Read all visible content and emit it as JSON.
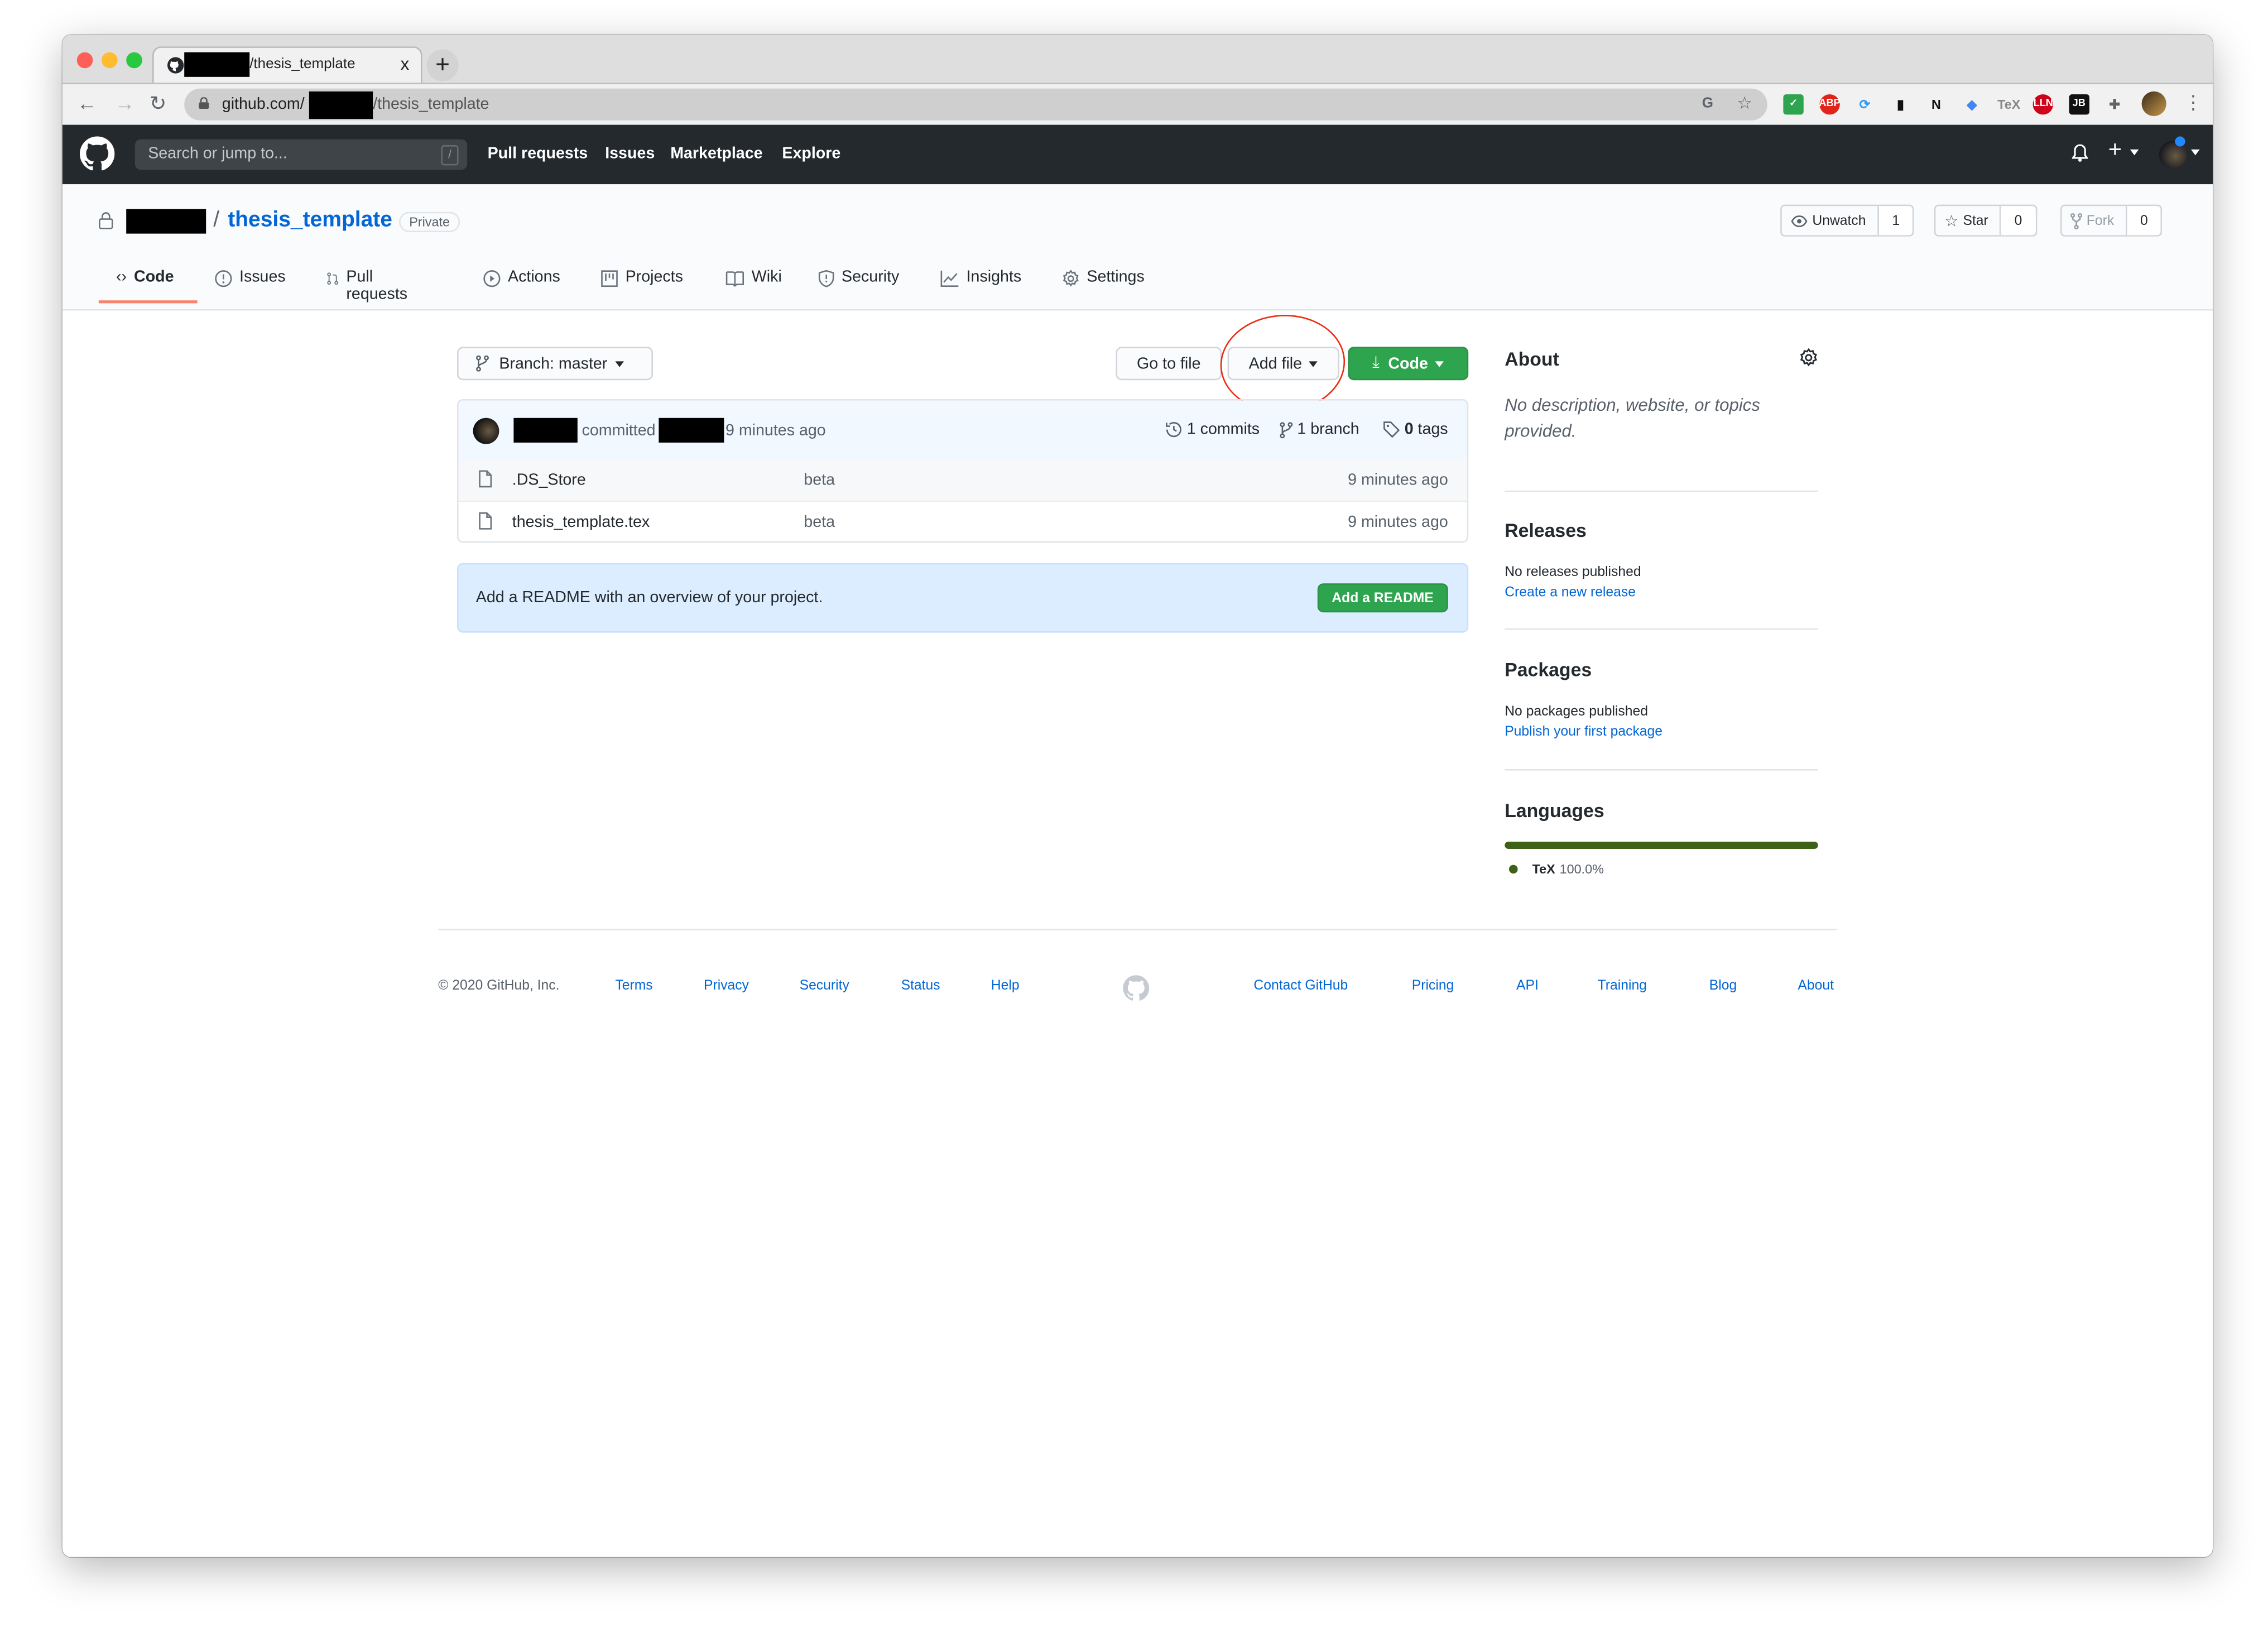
{
  "browser": {
    "tab_title": "/thesis_template",
    "tab_close": "x",
    "new_tab": "+",
    "url_host": "github.com/",
    "url_path": "/thesis_template",
    "extensions": [
      {
        "name": "check-extension-icon",
        "glyph": "✓",
        "color": "#2ea44f"
      },
      {
        "name": "adblock-plus-icon",
        "glyph": "ABP",
        "color": "#e2231a"
      },
      {
        "name": "sync-extension-icon",
        "glyph": "⟳",
        "color": "#2b9af3"
      },
      {
        "name": "bookmark-extension-icon",
        "glyph": "▮",
        "color": "#111111"
      },
      {
        "name": "notion-icon",
        "glyph": "N",
        "color": "#111111"
      },
      {
        "name": "diamond-extension-icon",
        "glyph": "◆",
        "color": "#4285f4"
      },
      {
        "name": "tex-extension-icon",
        "glyph": "TeX",
        "color": "#888888"
      },
      {
        "name": "lln-extension-icon",
        "glyph": "LLN",
        "color": "#d0021b"
      },
      {
        "name": "jetbrains-icon",
        "glyph": "JB",
        "color": "#111111"
      },
      {
        "name": "extensions-puzzle-icon",
        "glyph": "✚",
        "color": "#5f6368"
      }
    ]
  },
  "github_header": {
    "search_placeholder": "Search or jump to...",
    "search_shortcut": "/",
    "nav": [
      "Pull requests",
      "Issues",
      "Marketplace",
      "Explore"
    ]
  },
  "repo": {
    "separator": "/",
    "name": "thesis_template",
    "visibility": "Private",
    "watch": {
      "label": "Unwatch",
      "count": "1"
    },
    "star": {
      "label": "Star",
      "count": "0"
    },
    "fork": {
      "label": "Fork",
      "count": "0"
    },
    "tabs": [
      {
        "label": "Code",
        "active": true
      },
      {
        "label": "Issues"
      },
      {
        "label": "Pull requests"
      },
      {
        "label": "Actions"
      },
      {
        "label": "Projects"
      },
      {
        "label": "Wiki"
      },
      {
        "label": "Security"
      },
      {
        "label": "Insights"
      },
      {
        "label": "Settings"
      }
    ]
  },
  "toolbar": {
    "branch_label": "Branch: master",
    "go_to_file": "Go to file",
    "add_file": "Add file",
    "code": "Code"
  },
  "commit": {
    "verb": "committed",
    "time": "9 minutes ago",
    "commits": "1 commits",
    "branches": "1 branch",
    "tags_count": "0",
    "tags_label": "tags"
  },
  "files": [
    {
      "name": ".DS_Store",
      "message": "beta",
      "age": "9 minutes ago"
    },
    {
      "name": "thesis_template.tex",
      "message": "beta",
      "age": "9 minutes ago"
    }
  ],
  "readme_prompt": {
    "text": "Add a README with an overview of your project.",
    "button": "Add a README"
  },
  "sidebar": {
    "about_title": "About",
    "about_text": "No description, website, or topics provided.",
    "releases_title": "Releases",
    "releases_text": "No releases published",
    "releases_link": "Create a new release",
    "packages_title": "Packages",
    "packages_text": "No packages published",
    "packages_link": "Publish your first package",
    "languages_title": "Languages",
    "languages": [
      {
        "name": "TeX",
        "percent": "100.0%",
        "fraction": 1.0,
        "color": "#3d6117"
      }
    ]
  },
  "footer": {
    "copyright": "© 2020 GitHub, Inc.",
    "left_links": [
      "Terms",
      "Privacy",
      "Security",
      "Status",
      "Help"
    ],
    "right_links": [
      "Contact GitHub",
      "Pricing",
      "API",
      "Training",
      "Blog",
      "About"
    ]
  }
}
